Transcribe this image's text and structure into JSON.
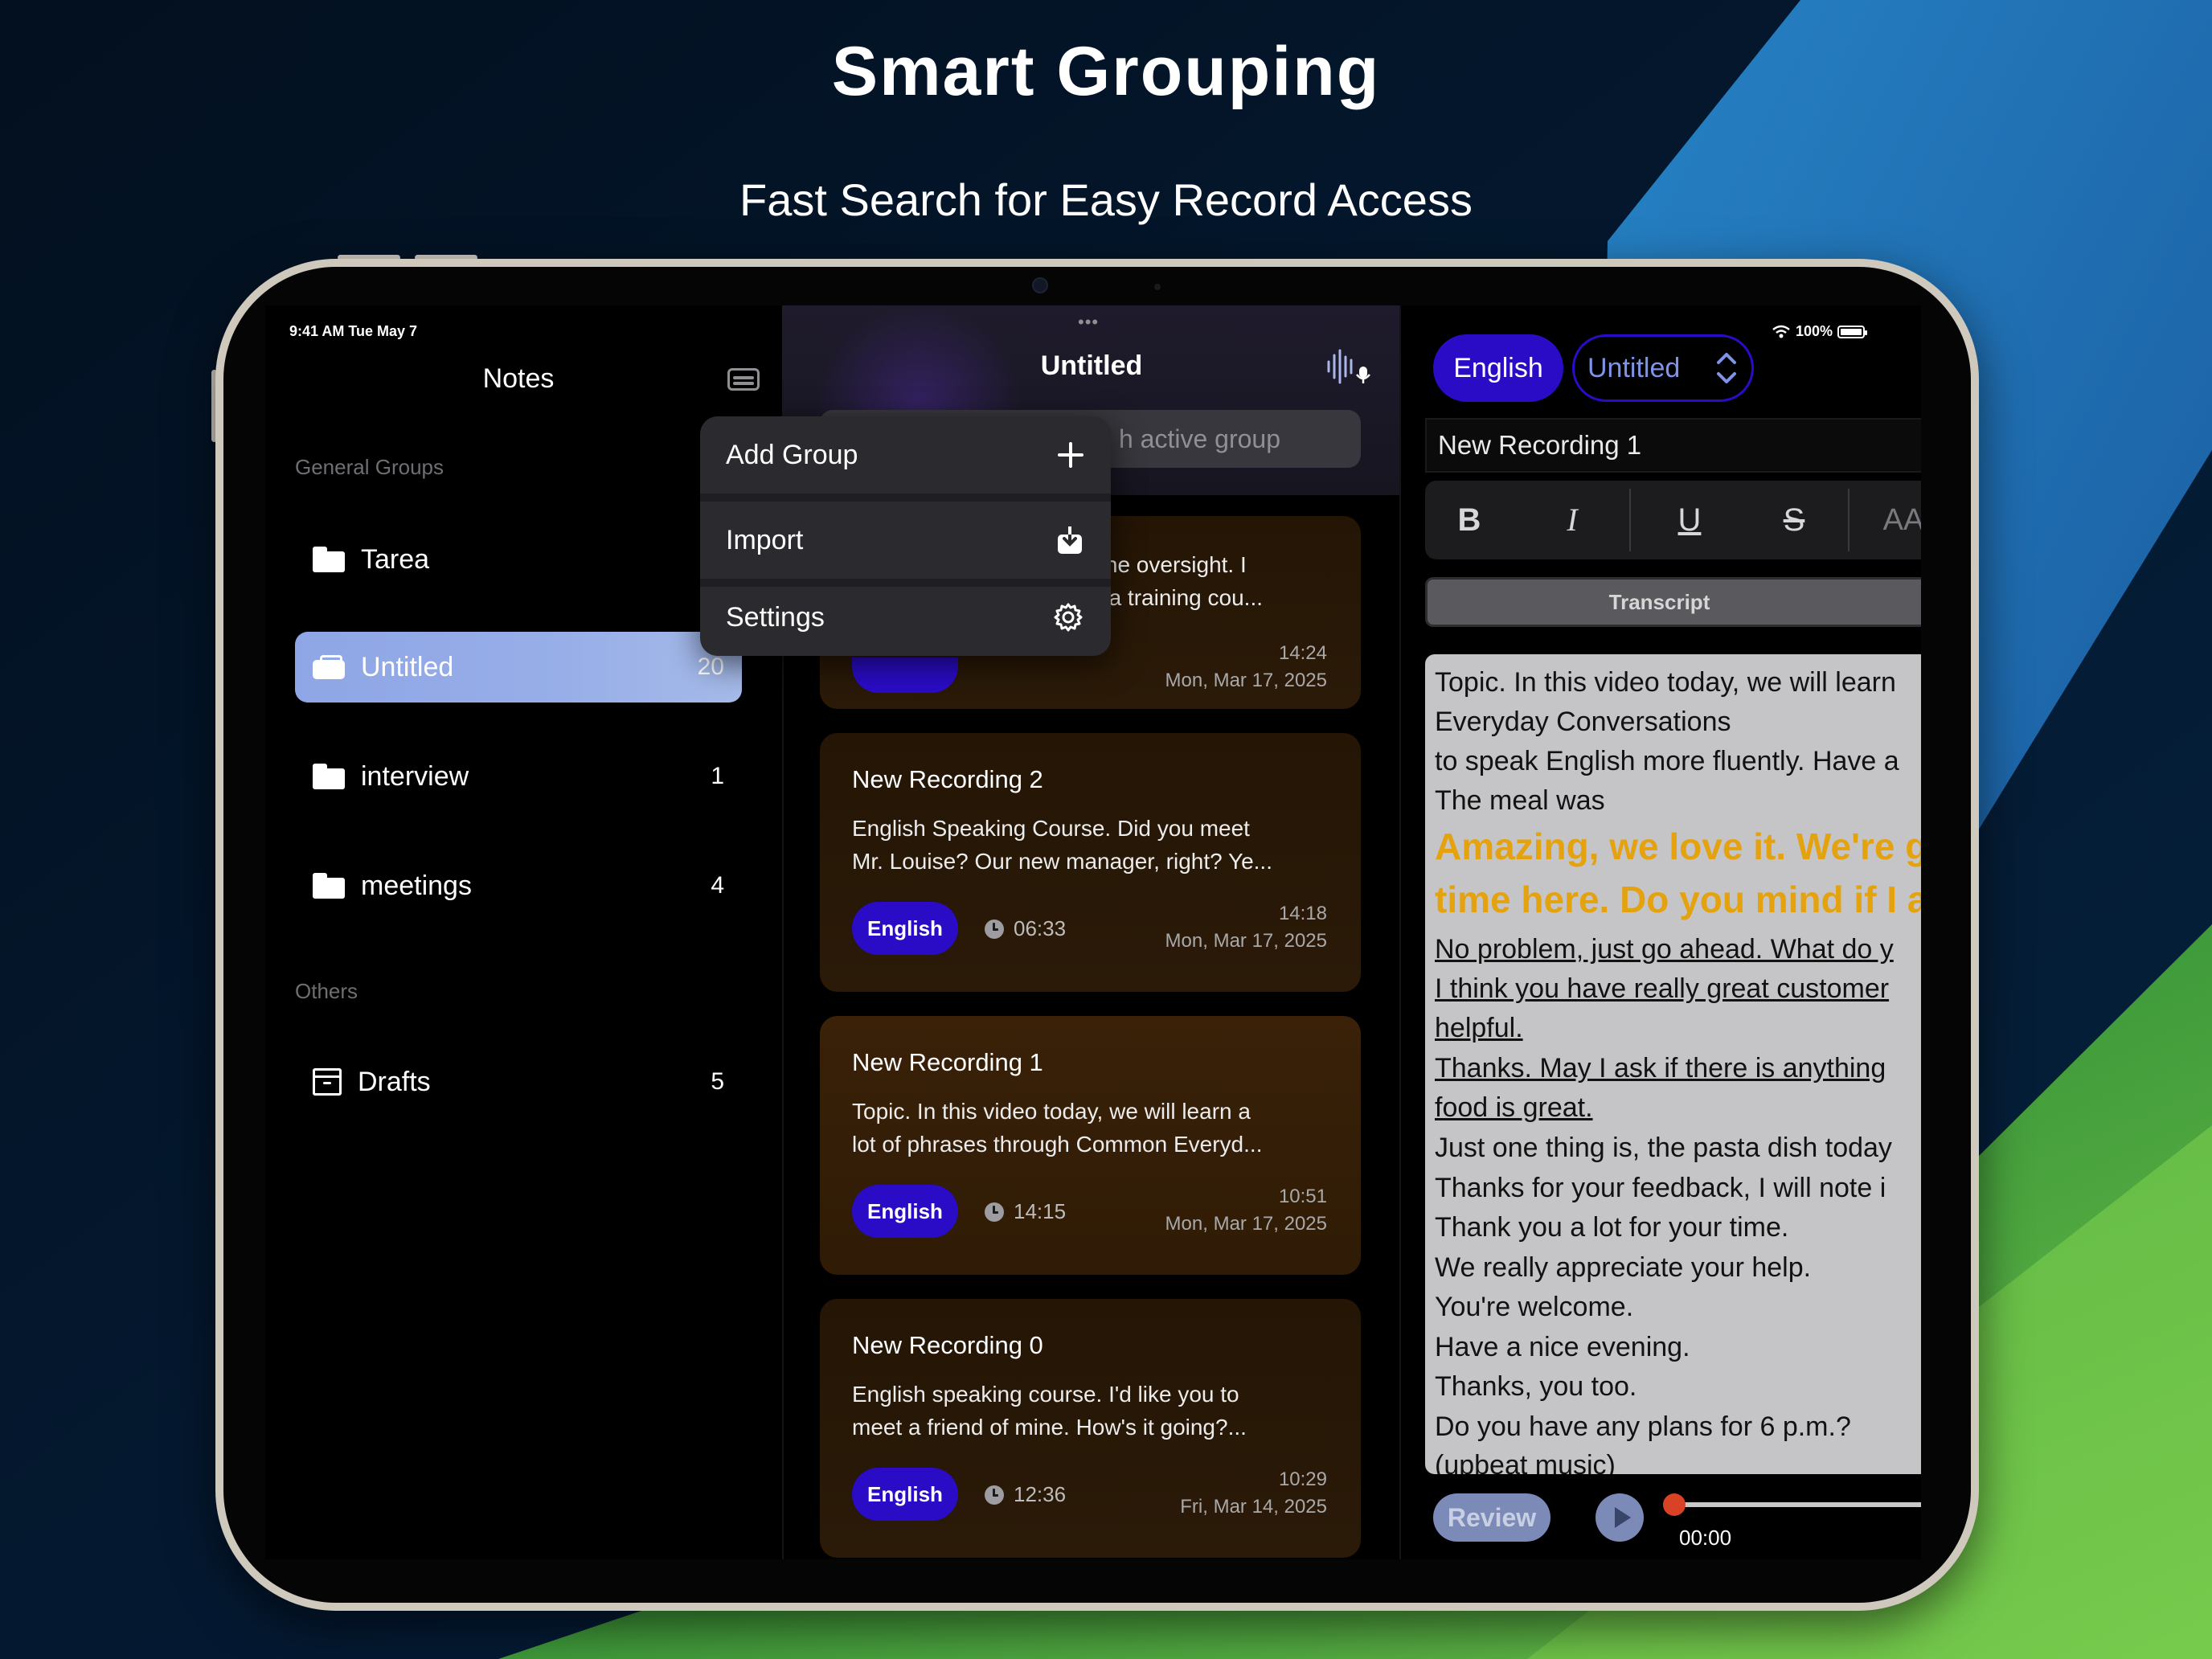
{
  "hero": {
    "title": "Smart Grouping",
    "subtitle": "Fast Search for Easy Record Access"
  },
  "status": {
    "time": "9:41 AM  Tue May 7",
    "battery": "100%"
  },
  "sidebar": {
    "title": "Notes",
    "general_groups_label": "General Groups",
    "others_label": "Others",
    "items": [
      {
        "label": "Tarea",
        "count": ""
      },
      {
        "label": "Untitled",
        "count": "20"
      },
      {
        "label": "interview",
        "count": "1"
      },
      {
        "label": "meetings",
        "count": "4"
      }
    ],
    "drafts": {
      "label": "Drafts",
      "count": "5"
    }
  },
  "menu": {
    "items": [
      {
        "label": "Add Group"
      },
      {
        "label": "Import"
      },
      {
        "label": "Settings"
      }
    ]
  },
  "list": {
    "title": "Untitled",
    "search_placeholder": "h active group",
    "cards": [
      {
        "title": "",
        "body_line1": "r the oversight. I",
        "body_line2": "in a training cou...",
        "lang": "",
        "duration": "",
        "time": "14:24",
        "date": "Mon, Mar 17, 2025"
      },
      {
        "title": "New Recording 2",
        "body_line1": " English Speaking Course. Did you meet",
        "body_line2": "Mr. Louise? Our new manager, right? Ye...",
        "lang": "English",
        "duration": "06:33",
        "time": "14:18",
        "date": "Mon, Mar 17, 2025"
      },
      {
        "title": "New Recording 1",
        "body_line1": "Topic. In this video today, we will learn a",
        "body_line2": "lot of phrases through Common Everyd...",
        "lang": "English",
        "duration": "14:15",
        "time": "10:51",
        "date": "Mon, Mar 17, 2025"
      },
      {
        "title": "New Recording 0",
        "body_line1": " English speaking course. I'd like you to",
        "body_line2": "meet a friend of mine. How's it going?...",
        "lang": "English",
        "duration": "12:36",
        "time": "10:29",
        "date": "Fri, Mar 14, 2025"
      }
    ]
  },
  "detail": {
    "lang": "English",
    "group": "Untitled",
    "recording_title": "New Recording 1",
    "format": {
      "bold": "B",
      "italic": "I",
      "underline": "U",
      "strike": "S",
      "size": "AA"
    },
    "transcript_tab": "Transcript",
    "lines": [
      "Topic. In this video today, we will learn",
      "Everyday Conversations",
      "to speak English more fluently. Have a",
      "The meal was",
      "Amazing, we love it. We're g",
      "time here. Do you mind if I a",
      "No problem, just go ahead. What do y",
      "I think you have really great customer",
      "helpful.",
      "Thanks. May I ask if there is anything",
      "food is great.",
      "Just one thing is, the pasta dish today",
      "Thanks for your feedback, I will note i",
      "Thank you a lot for your time.",
      "We really appreciate your help.",
      "You're welcome.",
      "Have a nice evening.",
      "Thanks, you too.",
      "Do you have any plans for 6 p.m.?",
      "(upbeat music)"
    ],
    "review_label": "Review",
    "playback_time": "00:00"
  },
  "colors": {
    "accent": "#2a0cc7",
    "highlight_text": "#e5a20f",
    "sidebar_active": "#8fa6e6",
    "card_bg": "#2b1a08"
  }
}
